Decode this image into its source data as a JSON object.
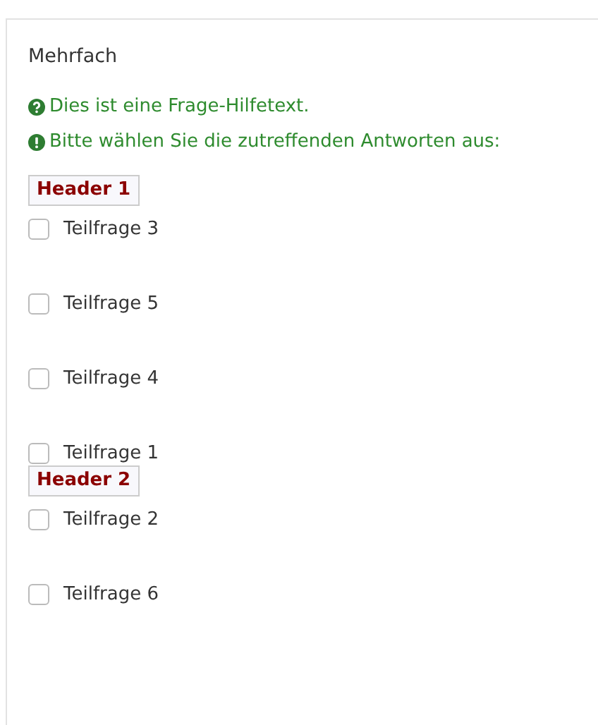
{
  "question": {
    "title": "Mehrfach"
  },
  "hints": [
    {
      "kind": "help",
      "text": "Dies ist eine Frage-Hilfetext."
    },
    {
      "kind": "info",
      "text": "Bitte wählen Sie die zutreffenden Antworten aus:"
    }
  ],
  "groups": [
    {
      "header": "Header 1",
      "options": [
        {
          "label": "Teilfrage 3",
          "checked": false
        },
        {
          "label": "Teilfrage 5",
          "checked": false
        },
        {
          "label": "Teilfrage 4",
          "checked": false
        },
        {
          "label": "Teilfrage 1",
          "checked": false
        }
      ]
    },
    {
      "header": "Header 2",
      "options": [
        {
          "label": "Teilfrage 2",
          "checked": false
        },
        {
          "label": "Teilfrage 6",
          "checked": false
        }
      ]
    }
  ]
}
